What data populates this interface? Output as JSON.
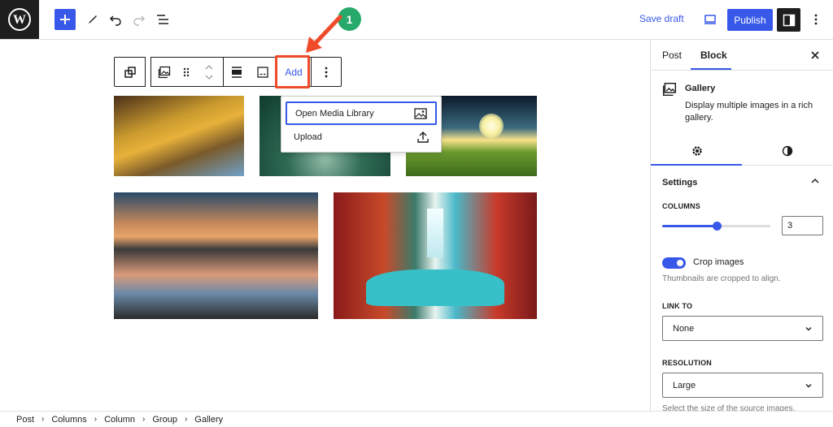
{
  "topbar": {
    "save_draft": "Save draft",
    "publish": "Publish",
    "icons": [
      "wordpress-logo",
      "plus-icon",
      "pen-icon",
      "undo-icon",
      "redo-icon",
      "list-view-icon",
      "preview-icon",
      "sidebar-icon",
      "more-vertical-icon"
    ]
  },
  "toolbar": {
    "add_label": "Add",
    "callout_number": "1"
  },
  "dropdown": {
    "items": [
      {
        "label": "Open Media Library",
        "icon": "image-icon"
      },
      {
        "label": "Upload",
        "icon": "upload-icon"
      }
    ]
  },
  "sidebar": {
    "tabs": [
      "Post",
      "Block"
    ],
    "active_tab": "Block",
    "block": {
      "title": "Gallery",
      "description": "Display multiple images in a rich gallery."
    },
    "panel_title": "Settings",
    "columns_label": "COLUMNS",
    "columns_value": "3",
    "columns_slider_fraction": 0.5,
    "crop_label": "Crop images",
    "crop_enabled": true,
    "crop_help": "Thumbnails are cropped to align.",
    "link_to_label": "LINK TO",
    "link_to_value": "None",
    "resolution_label": "RESOLUTION",
    "resolution_value": "Large",
    "resolution_help": "Select the size of the source images."
  },
  "breadcrumb": [
    "Post",
    "Columns",
    "Column",
    "Group",
    "Gallery"
  ],
  "colors": {
    "accent": "#3858e9",
    "highlight": "#ef4a2a",
    "callout": "#27a96b",
    "dark": "#1e1e1e"
  }
}
